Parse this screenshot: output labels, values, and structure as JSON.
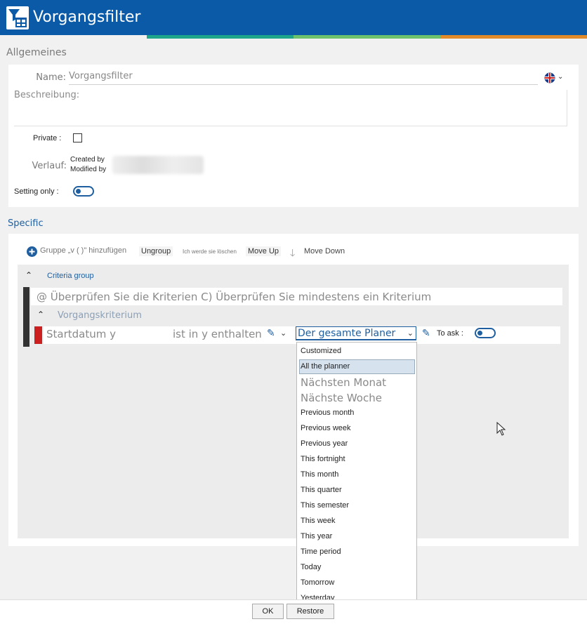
{
  "window": {
    "title": "Vorgangsfilter"
  },
  "colors": {
    "header": "#0a5aa8",
    "accent": "#1f5fa0",
    "stripe_teal": "#1fa58a",
    "stripe_green": "#6cc26c",
    "stripe_orange": "#e08a2a",
    "criterion_marker": "#cc1f1f"
  },
  "general": {
    "section_title": "Allgemeines",
    "name_label": "Name:",
    "name_value": "Vorgangsfilter",
    "description_label": "Beschreibung:",
    "private_label": "Private :",
    "history_label": "Verlauf:",
    "created_by": "Created by",
    "modified_by": "Modified by",
    "setting_only_label": "Setting only :",
    "language_icon": "uk-flag-icon"
  },
  "specific": {
    "section_title": "Specific",
    "toolbar": {
      "add_group": "Gruppe „v ( )\" hinzufügen",
      "ungroup": "Ungroup",
      "delete": "Ich werde sie löschen",
      "move_up": "Move Up",
      "move_down": "Move Down"
    },
    "criteria_group_label": "Criteria group",
    "check_rule": "@ Überprüfen Sie die Kriterien C) Überprüfen Sie mindestens ein Kriterium",
    "criterion_label": "Vorgangskriterium",
    "criterion": {
      "field": "Startdatum y",
      "operator": "ist in y enthalten",
      "value": "Der gesamte Planer",
      "to_ask_label": "To ask :"
    },
    "dropdown_options": [
      "Customized",
      "All the planner",
      "Nächsten Monat",
      "Nächste Woche",
      "Previous month",
      "Previous week",
      "Previous year",
      "This fortnight",
      "This month",
      "This quarter",
      "This semester",
      "This week",
      "This year",
      "Time period",
      "Today",
      "Tomorrow",
      "Yesterday"
    ],
    "selected_option": "All the planner"
  },
  "footer": {
    "ok": "OK",
    "restore": "Restore"
  }
}
